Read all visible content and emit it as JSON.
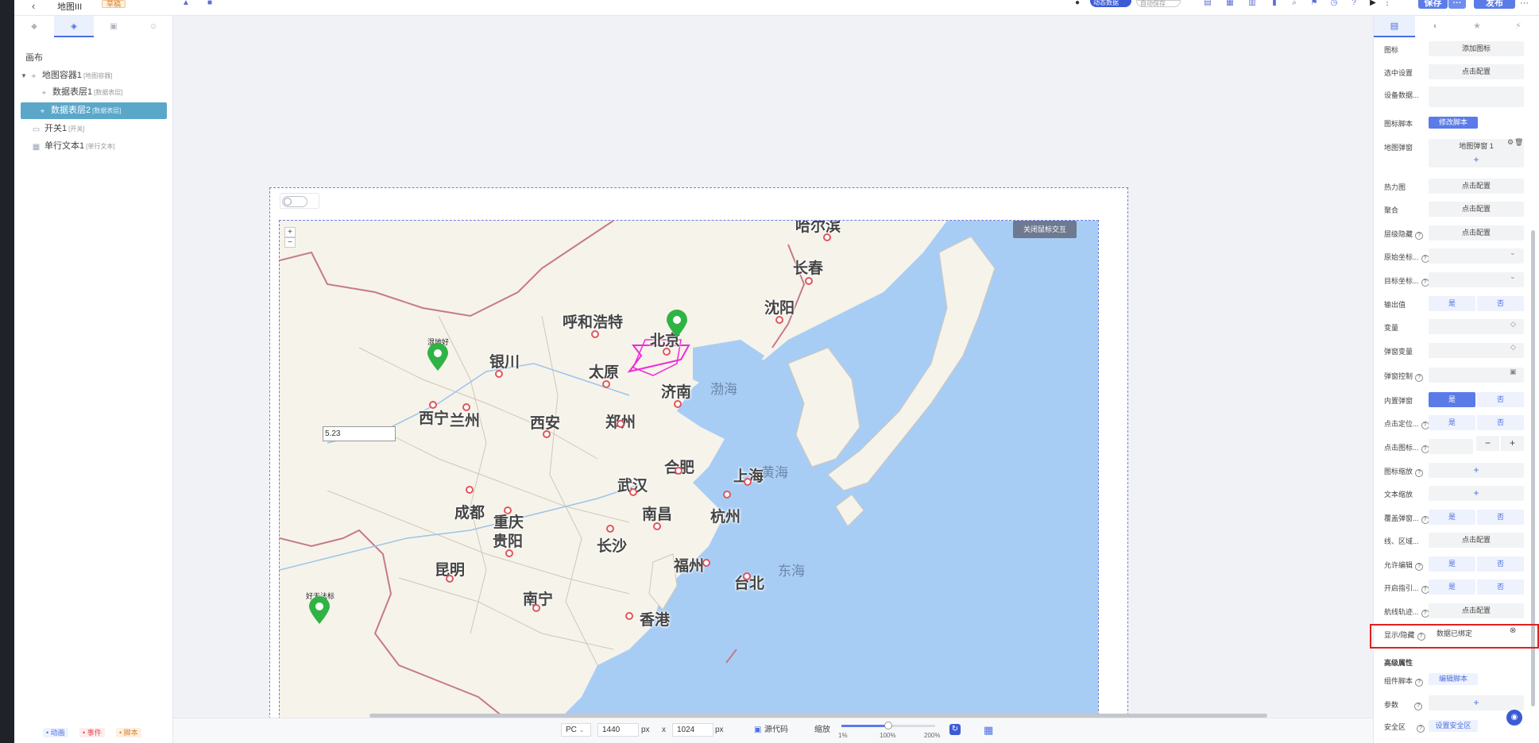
{
  "topbar": {
    "back": "‹",
    "title": "地图III",
    "tag": "草稿",
    "toggle_dynamic": "动态数据",
    "toggle_auto": "自动保存",
    "save_label": "保存",
    "publish_label": "发布",
    "more_label": "···"
  },
  "left_panel": {
    "section_label": "画布",
    "tree": [
      {
        "label": "地图容器1",
        "sub": "[地图容器]"
      },
      {
        "label": "数据表层1",
        "sub": "[数据表层]"
      },
      {
        "label": "数据表层2",
        "sub": "[数据表层]"
      },
      {
        "label": "开关1",
        "sub": "[开关]"
      },
      {
        "label": "单行文本1",
        "sub": "[单行文本]"
      }
    ],
    "footer": {
      "anim": "• 动画",
      "event": "• 事件",
      "script": "• 脚本"
    }
  },
  "map": {
    "close_interaction": "关闭鼠标交互",
    "zoom_in": "+",
    "zoom_out": "−",
    "input_value": "5.23",
    "cities": {
      "harbin": "哈尔滨",
      "changchun": "长春",
      "shenyang": "沈阳",
      "hohhot": "呼和浩特",
      "beijing": "北京",
      "yinchuan": "银川",
      "taiyuan": "太原",
      "jinan": "济南",
      "xining": "西宁",
      "lanzhou": "兰州",
      "xian": "西安",
      "zhengzhou": "郑州",
      "hefei": "合肥",
      "shanghai": "上海",
      "wuhan": "武汉",
      "chengdu": "成都",
      "chongqing": "重庆",
      "nanchang": "南昌",
      "hangzhou": "杭州",
      "guiyang": "贵阳",
      "changsha": "长沙",
      "kunming": "昆明",
      "fuzhou": "福州",
      "taipei": "台北",
      "nanning": "南宁",
      "hongkong": "香港"
    },
    "seas": {
      "bohai": "渤海",
      "yellow": "黄海",
      "east": "东海"
    },
    "pins": {
      "pin1": "湿地好",
      "pin2": "好无法标"
    }
  },
  "bottombar": {
    "device": "PC",
    "width": "1440",
    "height": "1024",
    "unit": "px",
    "times": "x",
    "source": "源代码",
    "zoom_label": "缩放",
    "zoom_min": "1%",
    "zoom_mid": "100%",
    "zoom_max": "200%",
    "zoom_level": 0.5
  },
  "right_panel": {
    "rows": [
      {
        "label": "图标",
        "value": "添加图标",
        "kind": "box"
      },
      {
        "label": "选中设置",
        "value": "点击配置",
        "kind": "box"
      },
      {
        "label": "设备数据...",
        "value": "",
        "kind": "box"
      },
      {
        "label": "图标脚本",
        "value": "修改脚本",
        "kind": "btn"
      },
      {
        "label": "地图弹窗",
        "value": "地图弹窗 1",
        "kind": "box"
      },
      {
        "label": "热力图",
        "value": "点击配置",
        "kind": "box"
      },
      {
        "label": "聚合",
        "value": "点击配置",
        "kind": "box"
      },
      {
        "label": "层级隐藏",
        "value": "点击配置",
        "kind": "box"
      },
      {
        "label": "原始坐标...",
        "value": "",
        "kind": "box"
      },
      {
        "label": "目标坐标...",
        "value": "",
        "kind": "box"
      },
      {
        "label": "输出值",
        "yes": "是",
        "no": "否",
        "kind": "seg"
      },
      {
        "label": "变量",
        "value": "",
        "kind": "box"
      },
      {
        "label": "弹窗变量",
        "value": "",
        "kind": "box"
      },
      {
        "label": "弹窗控制",
        "value": "",
        "kind": "box"
      },
      {
        "label": "内置弹窗",
        "yes": "是",
        "no": "否",
        "kind": "seg"
      },
      {
        "label": "点击定位...",
        "yes": "是",
        "no": "否",
        "kind": "seg"
      },
      {
        "label": "点击图标...",
        "value": "",
        "kind": "box"
      },
      {
        "label": "图标缩放",
        "value": "+",
        "kind": "box"
      },
      {
        "label": "文本缩放",
        "value": "+",
        "kind": "box"
      },
      {
        "label": "覆盖弹窗...",
        "yes": "是",
        "no": "否",
        "kind": "seg"
      },
      {
        "label": "线、区域...",
        "value": "点击配置",
        "kind": "box"
      },
      {
        "label": "允许编辑",
        "yes": "是",
        "no": "否",
        "kind": "seg"
      },
      {
        "label": "开启指引...",
        "yes": "是",
        "no": "否",
        "kind": "seg"
      },
      {
        "label": "航线轨迹...",
        "value": "点击配置",
        "kind": "box"
      },
      {
        "label": "显示/隐藏",
        "value": "数据已绑定",
        "kind": "box"
      }
    ],
    "advanced_title": "高级属性",
    "component_script_label": "组件脚本",
    "component_script_btn": "编辑脚本",
    "params_label": "参数",
    "params_value": "+",
    "safe_area_label": "安全区",
    "safe_area_btn": "设置安全区",
    "popup_add": "+",
    "stepper_minus": "−",
    "stepper_plus": "+"
  }
}
